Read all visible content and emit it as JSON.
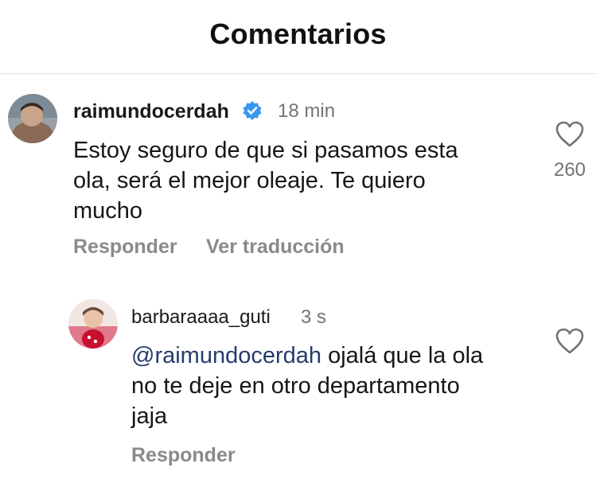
{
  "header": {
    "title": "Comentarios"
  },
  "comments": [
    {
      "username": "raimundocerdah",
      "verified": true,
      "time": "18 min",
      "text_lines": [
        "Estoy seguro de que si pasamos esta",
        "ola, será el mejor oleaje. Te quiero",
        "mucho"
      ],
      "likes": "260",
      "actions": {
        "reply": "Responder",
        "translate": "Ver traducción"
      },
      "icons": {
        "like": "heart-outline-icon",
        "badge": "verified-badge-icon"
      }
    },
    {
      "username": "barbaraaaa_guti",
      "verified": false,
      "time": "3 s",
      "mention": "@raimundocerdah",
      "text_lines": [
        " ojalá que la ola",
        "no te deje en otro departamento",
        "jaja"
      ],
      "actions": {
        "reply": "Responder"
      },
      "icons": {
        "like": "heart-outline-icon"
      }
    }
  ],
  "colors": {
    "verified_badge": "#3897f0",
    "mention": "#263b6e",
    "secondary_text": "#737373"
  }
}
